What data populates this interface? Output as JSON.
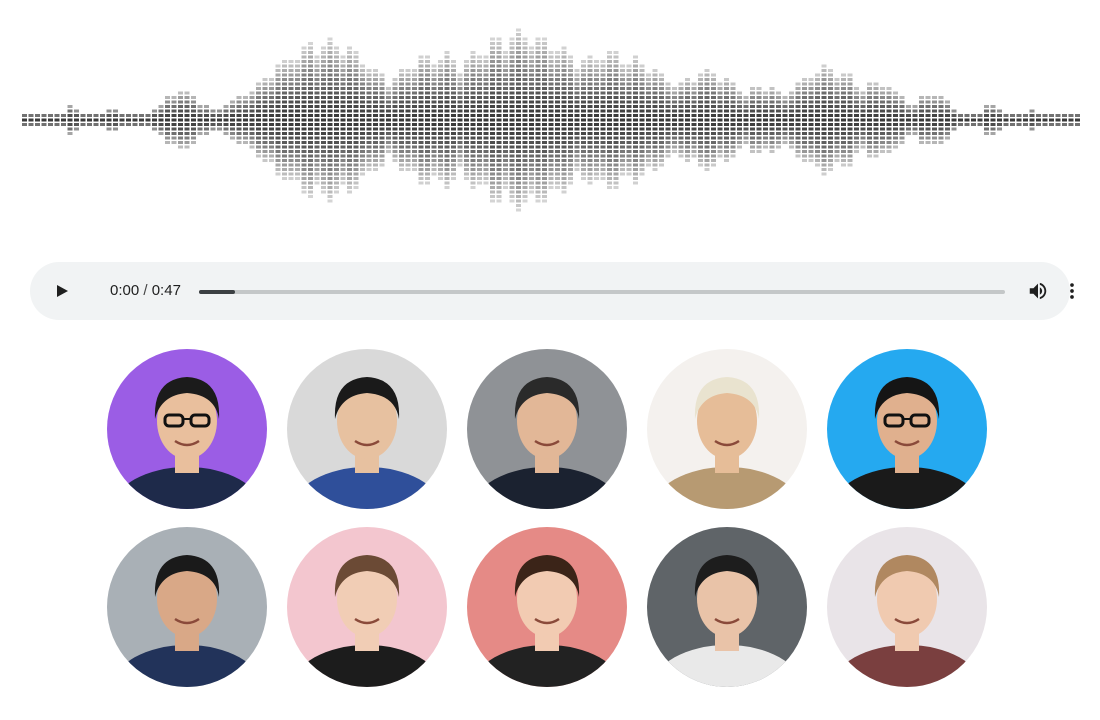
{
  "player": {
    "time_current": "0:00",
    "time_separator": " / ",
    "time_total": "0:47",
    "progress_fraction": 0.045,
    "play_icon": "play-icon",
    "volume_icon": "volume-icon",
    "more_icon": "more-vertical-icon"
  },
  "waveform": {
    "bar_color": "#3a3a3a",
    "icon": "audio-waveform"
  },
  "avatars": [
    {
      "name": "avatar-1",
      "bg": "#9b5de5",
      "skin": "#e9bf9d",
      "hair": "#1b1b1b",
      "top": "#1e2a4a",
      "glasses": true
    },
    {
      "name": "avatar-2",
      "bg": "#d9d9d9",
      "skin": "#e7c1a0",
      "hair": "#1a1a1a",
      "top": "#2f4f9a",
      "glasses": false
    },
    {
      "name": "avatar-3",
      "bg": "#8f9296",
      "skin": "#e2b797",
      "hair": "#2a2a2a",
      "top": "#1b2230",
      "glasses": false
    },
    {
      "name": "avatar-4",
      "bg": "#f4f1ee",
      "skin": "#e6bd98",
      "hair": "#e9e3cf",
      "top": "#b79a72",
      "glasses": false
    },
    {
      "name": "avatar-5",
      "bg": "#25a9f0",
      "skin": "#e0b08e",
      "hair": "#151515",
      "top": "#1a1a1a",
      "glasses": true
    },
    {
      "name": "avatar-6",
      "bg": "#a9b0b6",
      "skin": "#d9a887",
      "hair": "#1a1a1a",
      "top": "#22335a",
      "glasses": false
    },
    {
      "name": "avatar-7",
      "bg": "#f3c6cf",
      "skin": "#f1cdb5",
      "hair": "#6b4a35",
      "top": "#1c1c1c",
      "glasses": false
    },
    {
      "name": "avatar-8",
      "bg": "#e58a86",
      "skin": "#f2cbb2",
      "hair": "#3b2418",
      "top": "#222222",
      "glasses": false
    },
    {
      "name": "avatar-9",
      "bg": "#5f6468",
      "skin": "#e9c3a8",
      "hair": "#1d1d1d",
      "top": "#e9e9e9",
      "glasses": false
    },
    {
      "name": "avatar-10",
      "bg": "#e9e4e8",
      "skin": "#f0cab0",
      "hair": "#b08860",
      "top": "#7a3f3f",
      "glasses": false
    }
  ]
}
